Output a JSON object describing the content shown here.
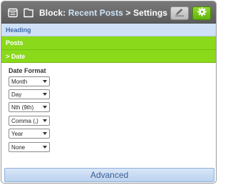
{
  "header": {
    "block_prefix": "Block:",
    "block_name": "Recent Posts",
    "separator": " > ",
    "page": "Settings",
    "icons": {
      "list": "list-icon",
      "box": "block-icon",
      "edit": "pencil-icon",
      "settings": "gear-icon"
    }
  },
  "sections": {
    "heading": "Heading",
    "posts": "Posts",
    "date": "> Date"
  },
  "form": {
    "label": "Date Format",
    "selects": [
      "Month",
      "Day",
      "Nth (9th)",
      "Comma (,)",
      "Year",
      "None"
    ]
  },
  "footer": {
    "advanced": "Advanced"
  },
  "colors": {
    "accent_green": "#8ad91b",
    "heading_blue": "#cfe0f7",
    "header_gray": "#6a6a6a"
  }
}
